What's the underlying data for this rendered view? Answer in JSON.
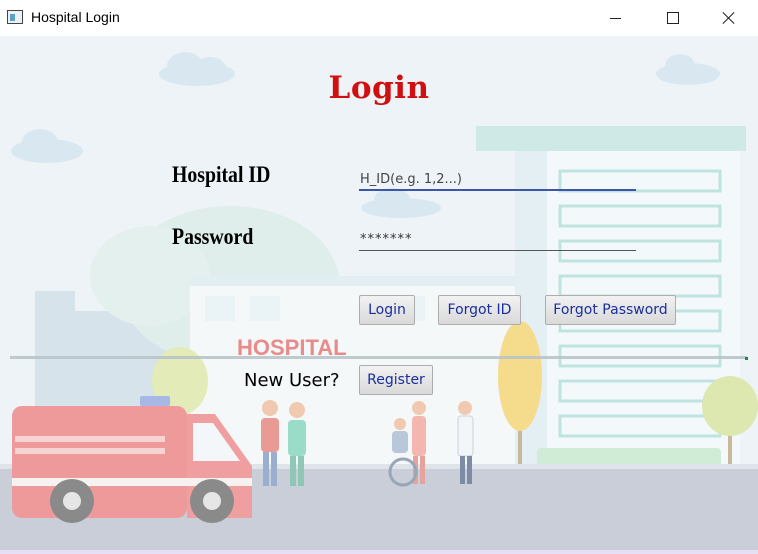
{
  "window": {
    "title": "Hospital Login"
  },
  "heading": "Login",
  "hospital_id": {
    "label": "Hospital ID",
    "placeholder": "H_ID(e.g. 1,2...)"
  },
  "password": {
    "label": "Password",
    "value": "*******"
  },
  "buttons": {
    "login": "Login",
    "forgot_id": "Forgot ID",
    "forgot_password": "Forgot Password",
    "register": "Register"
  },
  "new_user_label": "New User?",
  "background": {
    "sign_text": "HOSPITAL"
  },
  "colors": {
    "heading": "#d01010",
    "button_text": "#1a2f9c",
    "focus_underline": "#3b56a6",
    "sign": "#e98b8b"
  }
}
